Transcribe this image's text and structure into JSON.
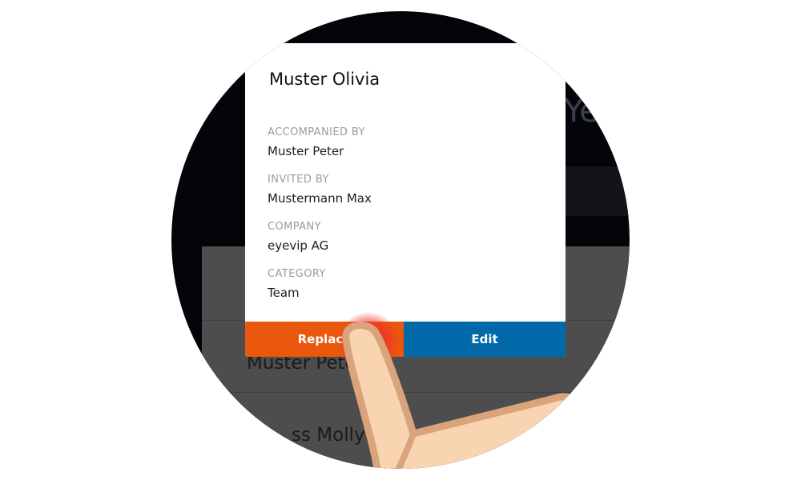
{
  "background": {
    "title_fragment": "Ye",
    "rows": [
      {
        "name": "Muster Peter"
      },
      {
        "name": "ss Molly"
      }
    ]
  },
  "popup": {
    "title": "Muster Olivia",
    "fields": [
      {
        "label": "ACCOMPANIED BY",
        "value": "Muster Peter"
      },
      {
        "label": "INVITED BY",
        "value": "Mustermann Max"
      },
      {
        "label": "COMPANY",
        "value": "eyevip AG"
      },
      {
        "label": "CATEGORY",
        "value": "Team"
      }
    ],
    "buttons": {
      "replace_label": "Replace",
      "edit_label": "Edit"
    }
  },
  "colors": {
    "replace": "#e9580c",
    "edit": "#0169a7",
    "tap_indicator": "#ff2a2a",
    "finger": "#f9d4b0"
  },
  "icons": {
    "pointer": "tapping-finger"
  }
}
